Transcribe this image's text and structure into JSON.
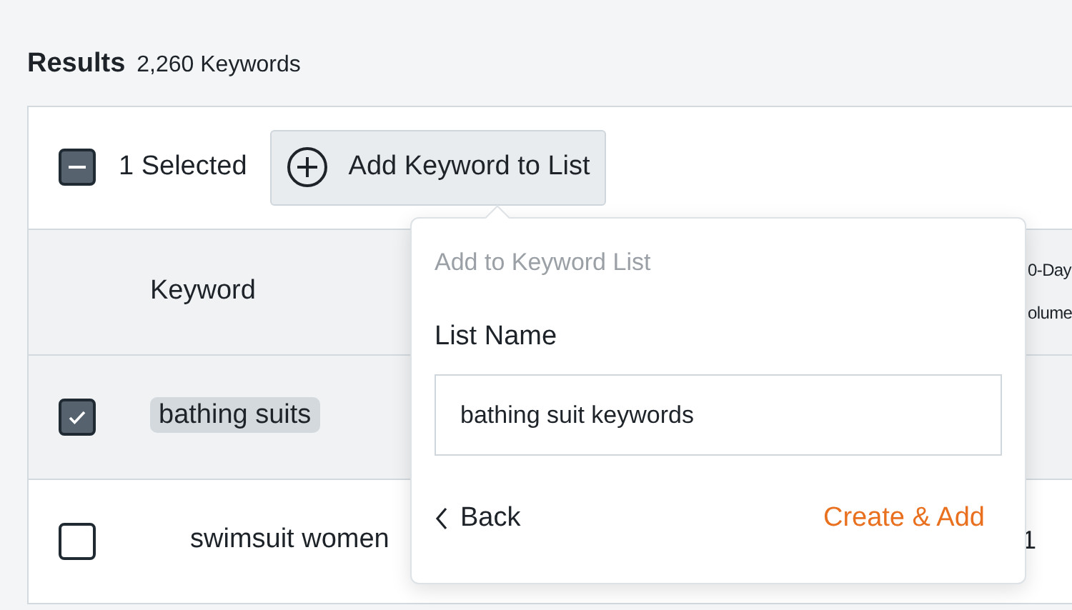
{
  "results": {
    "title": "Results",
    "count": "2,260 Keywords"
  },
  "toolbar": {
    "selection_checkbox": {
      "indeterminate": true
    },
    "selected_label": "1 Selected",
    "add_button": "Add Keyword to List"
  },
  "table": {
    "columns": [
      "Keyword",
      {
        "lines": [
          "0-Day",
          "olume"
        ]
      }
    ],
    "rows": [
      {
        "keyword": "bathing suits",
        "selected": true
      },
      {
        "keyword": "swimsuit women",
        "selected": false,
        "column_2": "1"
      }
    ]
  },
  "popover": {
    "title": "Add to Keyword List",
    "field_label": "List Name",
    "field_value": "bathing suit keywords",
    "back": "Back",
    "submit": "Create & Add"
  }
}
